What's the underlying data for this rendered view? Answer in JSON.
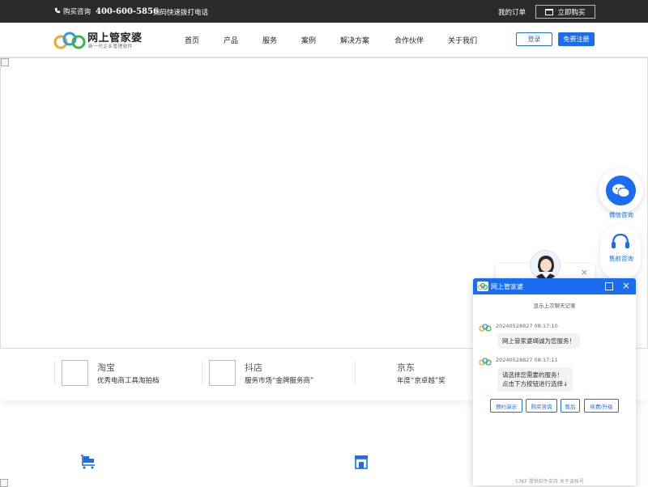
{
  "topbar": {
    "consult_label": "购买咨询",
    "phone": "400-600-5856",
    "scan_text": "扫码快速拨打电话",
    "my_order": "我的订单",
    "buy_now": "立即购买"
  },
  "header": {
    "logo_title": "网上管家婆",
    "logo_subtitle": "新一代企业管理软件",
    "nav": [
      "首页",
      "产品",
      "服务",
      "案例",
      "解决方案",
      "合作伙伴",
      "关于我们"
    ],
    "login": "登录",
    "register": "免费注册"
  },
  "partners": [
    {
      "name": "淘宝",
      "desc": "优秀电商工具淘拍档"
    },
    {
      "name": "抖店",
      "desc": "服务市场“金牌服务商”"
    },
    {
      "name": "京东",
      "desc": "年度“京卓越”奖"
    }
  ],
  "floating": {
    "wechat_label": "微信咨询",
    "presale_label": "售前咨询"
  },
  "chat": {
    "title": "网上管家婆",
    "history_link": "显示上次聊天记录",
    "messages": [
      {
        "time": "20240528827  08:17:10",
        "text": [
          "网上管家婆竭诚为您服务！"
        ]
      },
      {
        "time": "20240528827  08:17:11",
        "text": [
          "请选择您需要的服务！",
          "点击下方按钮进行选择↓"
        ]
      }
    ],
    "quick_buttons": [
      "预约演示",
      "购买咨询",
      "售后",
      "续费/升级"
    ],
    "powered": "53KF 提供软件支持   关于该账号"
  },
  "colors": {
    "accent": "#1a6cf0",
    "topbar": "#2b2b2b"
  }
}
